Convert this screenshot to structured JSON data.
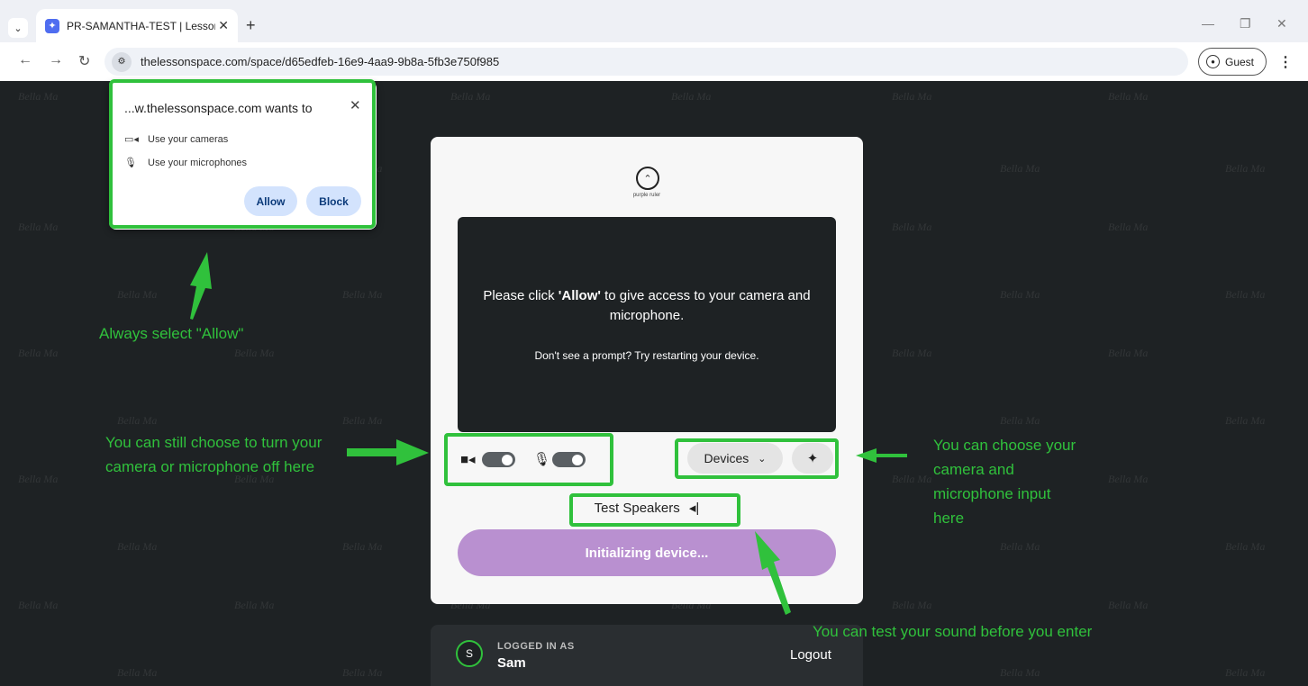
{
  "browser": {
    "tab_title": "PR-SAMANTHA-TEST | Lessonspace",
    "url": "thelessonspace.com/space/d65edfeb-16e9-4aa9-9b8a-5fb3e750f985",
    "profile_label": "Guest"
  },
  "permission": {
    "title": "...w.thelessonspace.com wants to",
    "rows": [
      "Use your cameras",
      "Use your microphones"
    ],
    "allow_label": "Allow",
    "block_label": "Block"
  },
  "card": {
    "brand": "purple ruler",
    "message_pre": "Please click ",
    "message_bold": "'Allow'",
    "message_post": " to give access to your camera and microphone.",
    "hint": "Don't see a prompt? Try restarting your device.",
    "devices_label": "Devices",
    "test_speakers_label": "Test Speakers",
    "init_label": "Initializing device..."
  },
  "footer": {
    "logged_in_label": "LOGGED IN AS",
    "user_initial": "S",
    "user_name": "Sam",
    "logout_label": "Logout"
  },
  "annotations": {
    "allow": "Always select \"Allow\"",
    "toggles": "You can still choose to turn your camera or microphone off here",
    "devices": "You can choose your camera and microphone input here",
    "speakers": "You can test your sound before you enter"
  },
  "watermark": "Bella Ma",
  "colors": {
    "annotation": "#30c13c",
    "init_button": "#b990d0",
    "page_bg": "#1e2224"
  }
}
